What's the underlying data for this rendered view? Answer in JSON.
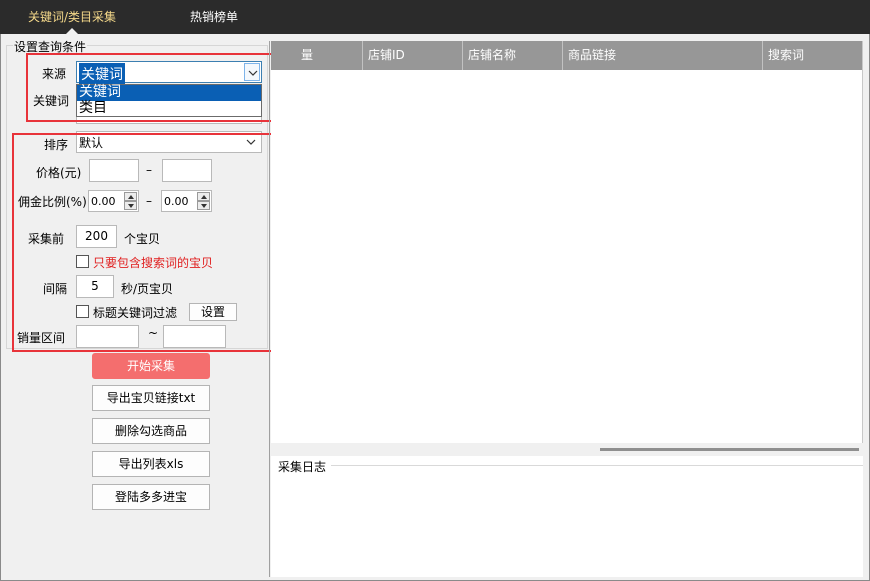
{
  "tabs": [
    {
      "label": "关键词/类目采集",
      "active": true
    },
    {
      "label": "热销榜单",
      "active": false
    }
  ],
  "query_group": {
    "title": "设置查询条件",
    "source": {
      "label": "来源",
      "value": "关键词",
      "options": [
        "关键词",
        "类目"
      ]
    },
    "keyword": {
      "label": "关键词",
      "value": ""
    },
    "sort": {
      "label": "排序",
      "value": "默认"
    },
    "price": {
      "label": "价格(元)",
      "min": "",
      "max": "",
      "separator": "–"
    },
    "commission": {
      "label": "佣金比例(%)",
      "min": "0.00",
      "max": "0.00",
      "separator": "–"
    },
    "collect_first": {
      "label": "采集前",
      "value": "200",
      "unit": "个宝贝"
    },
    "only_contains_keyword": {
      "label": "只要包含搜索词的宝贝",
      "checked": false
    },
    "interval": {
      "label": "间隔",
      "value": "5",
      "unit": "秒/页宝贝"
    },
    "title_filter": {
      "label": "标题关键词过滤",
      "checked": false,
      "button": "设置"
    },
    "sales_range": {
      "label": "销量区间",
      "min": "",
      "max": "",
      "separator": "~"
    }
  },
  "actions": {
    "start": "开始采集",
    "export_links": "导出宝贝链接txt",
    "delete_checked": "删除勾选商品",
    "export_xls": "导出列表xls",
    "login": "登陆多多进宝"
  },
  "table": {
    "columns": [
      "量",
      "店铺ID",
      "店铺名称",
      "商品链接",
      "搜索词"
    ]
  },
  "log": {
    "title": "采集日志"
  },
  "colors": {
    "tabbar": "#2b2b2b",
    "active_tab": "#f5d98a",
    "primary_button": "#f46e6e",
    "header": "#979797",
    "highlight": "#e8333a",
    "selection": "#0a5fb4"
  }
}
